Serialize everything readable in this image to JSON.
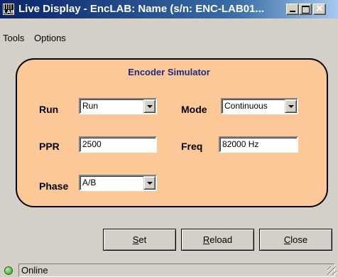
{
  "window": {
    "title": "Live Display - EncLAB: Name (s/n: ENC-LAB01...",
    "close_glyph": "×"
  },
  "app_icon": {
    "label": "LAB"
  },
  "menu": {
    "tools": "Tools",
    "options": "Options"
  },
  "panel": {
    "title": "Encoder Simulator",
    "run": {
      "label": "Run",
      "value": "Run"
    },
    "mode": {
      "label": "Mode",
      "value": "Continuous"
    },
    "ppr": {
      "label": "PPR",
      "value": "2500"
    },
    "freq": {
      "label": "Freq",
      "value": "82000 Hz"
    },
    "phase": {
      "label": "Phase",
      "value": "A/B"
    }
  },
  "buttons": {
    "set": {
      "mnemonic": "S",
      "rest": "et"
    },
    "reload": {
      "mnemonic": "R",
      "rest": "eload"
    },
    "close": {
      "mnemonic": "C",
      "rest": "lose"
    }
  },
  "status": {
    "text": "Online",
    "led_color": "#2c9a1a"
  },
  "colors": {
    "panel_bg": "#fdc897",
    "panel_title": "#1e2a80",
    "titlebar": "#0a246a"
  }
}
